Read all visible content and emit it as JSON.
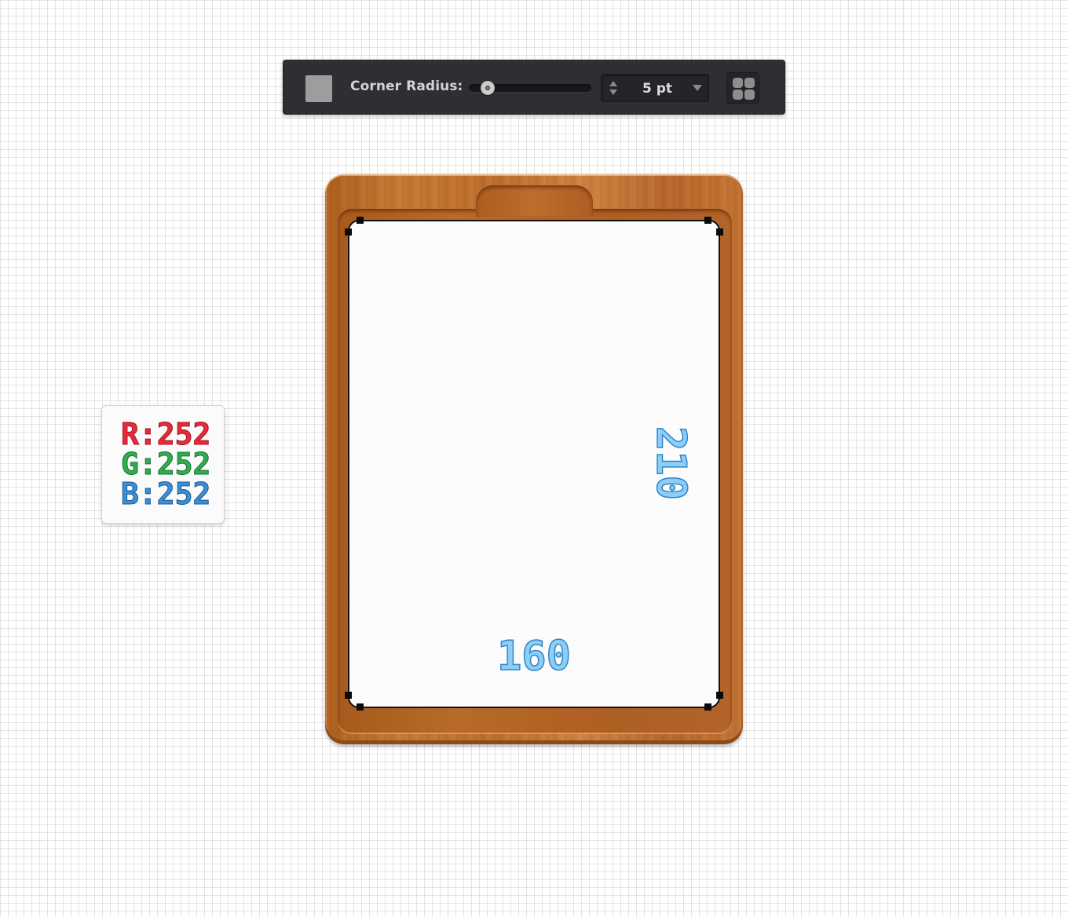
{
  "toolbar": {
    "shape_icon": "rounded-rectangle-icon",
    "corner_radius_label": "Corner Radius:",
    "radius_value": "5 pt",
    "slider_level": 0.1,
    "stepper_icon": "up-down-arrows-icon",
    "dropdown_icon": "chevron-down-icon",
    "corner_mode_icon": "four-corners-icon"
  },
  "color_readout": {
    "r_label": "R:",
    "r_value": "252",
    "g_label": "G:",
    "g_value": "252",
    "b_label": "B:",
    "b_value": "252",
    "colors": {
      "r": "#ea2a3a",
      "g": "#2fae4e",
      "b": "#3b8fd6"
    }
  },
  "canvas": {
    "paper_color": "#fcfcfc",
    "width_dimension": "160",
    "height_dimension": "210",
    "dimension_color": "#2e86cc",
    "wood_color": "#c77934"
  }
}
